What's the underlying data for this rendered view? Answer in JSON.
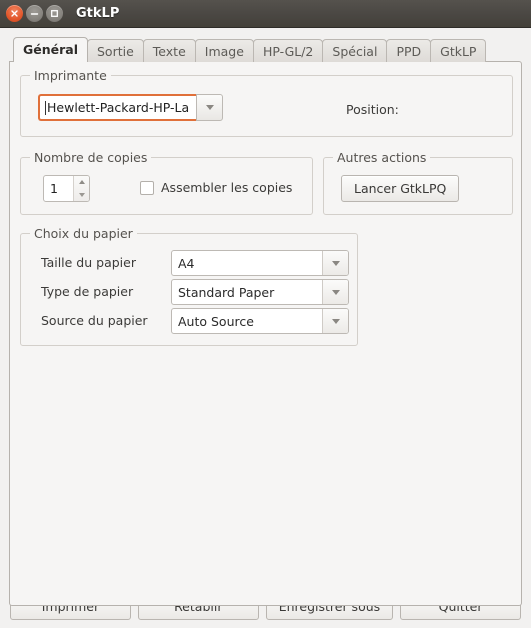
{
  "window": {
    "title": "GtkLP",
    "controls": [
      {
        "name": "close-button",
        "icon": "close-icon"
      },
      {
        "name": "minimize-button",
        "icon": "minimize-icon"
      },
      {
        "name": "maximize-button",
        "icon": "maximize-icon"
      }
    ]
  },
  "tabs": [
    {
      "label": "Général",
      "active": true
    },
    {
      "label": "Sortie",
      "active": false
    },
    {
      "label": "Texte",
      "active": false
    },
    {
      "label": "Image",
      "active": false
    },
    {
      "label": "HP-GL/2",
      "active": false
    },
    {
      "label": "Spécial",
      "active": false
    },
    {
      "label": "PPD",
      "active": false
    },
    {
      "label": "GtkLP",
      "active": false
    }
  ],
  "printer_group": {
    "legend": "Imprimante",
    "combo_value": "Hewlett-Packard-HP-La",
    "position_label": "Position:",
    "position_value": ""
  },
  "copies_group": {
    "legend": "Nombre de copies",
    "spin_value": "1",
    "collate_label": "Assembler les copies",
    "collate_checked": false
  },
  "other_actions_group": {
    "legend": "Autres actions",
    "button_label": "Lancer GtkLPQ"
  },
  "paper_group": {
    "legend": "Choix du papier",
    "rows": [
      {
        "label": "Taille du papier",
        "value": "A4"
      },
      {
        "label": "Type de papier",
        "value": "Standard Paper"
      },
      {
        "label": "Source du papier",
        "value": "Auto Source"
      }
    ]
  },
  "action_bar": {
    "buttons": [
      {
        "label": "Imprimer"
      },
      {
        "label": "Rétablir"
      },
      {
        "label": "Enregistrer sous"
      },
      {
        "label": "Quitter"
      }
    ]
  },
  "colors": {
    "titlebar": "#4a4743",
    "close_button": "#e2562a",
    "focus_ring": "#e0703a",
    "panel_bg": "#f6f5f4",
    "window_bg": "#f2f1f0"
  }
}
